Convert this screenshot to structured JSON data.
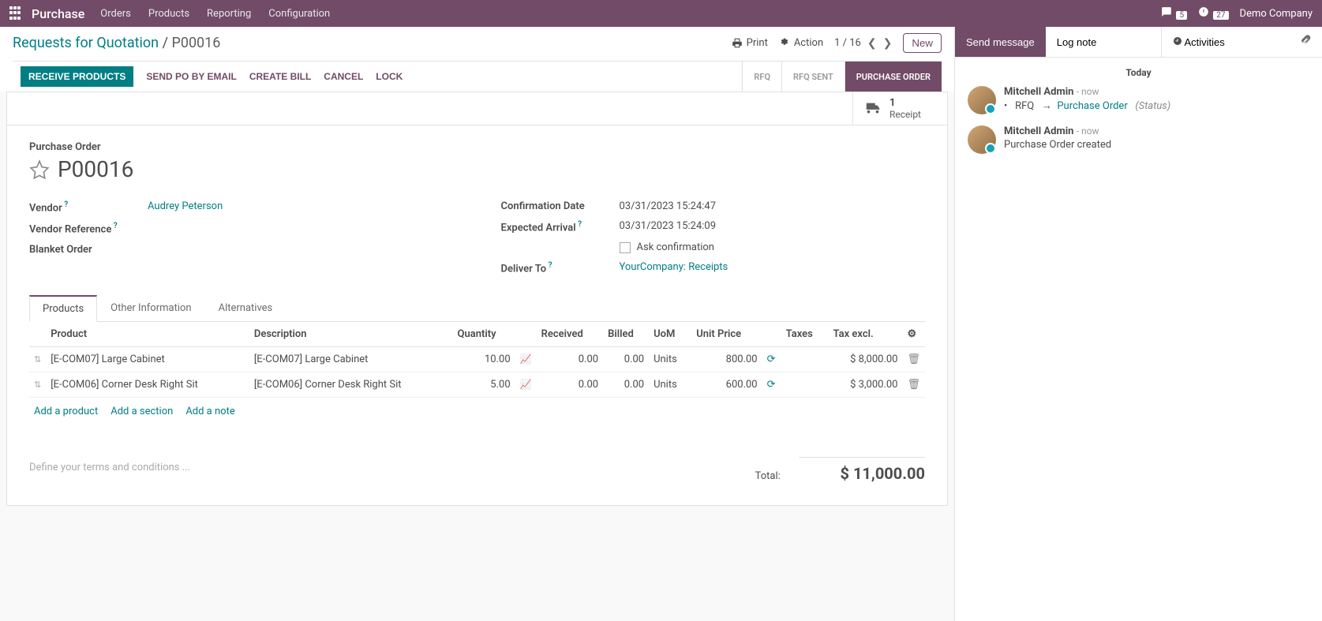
{
  "topnav": {
    "brand": "Purchase",
    "menu": [
      "Orders",
      "Products",
      "Reporting",
      "Configuration"
    ],
    "chat_badge": "5",
    "activity_badge": "27",
    "company": "Demo Company"
  },
  "breadcrumb": {
    "parent": "Requests for Quotation",
    "current": "P00016"
  },
  "control": {
    "print": "Print",
    "action": "Action",
    "pager": "1 / 16",
    "new": "New"
  },
  "actions": {
    "receive": "RECEIVE PRODUCTS",
    "sendpo": "SEND PO BY EMAIL",
    "createbill": "CREATE BILL",
    "cancel": "CANCEL",
    "lock": "LOCK"
  },
  "status": {
    "rfq": "RFQ",
    "rfqsent": "RFQ SENT",
    "po": "PURCHASE ORDER"
  },
  "stat": {
    "count": "1",
    "label": "Receipt"
  },
  "form": {
    "title_label": "Purchase Order",
    "name": "P00016",
    "vendor_label": "Vendor",
    "vendor": "Audrey Peterson",
    "vendor_ref_label": "Vendor Reference",
    "blanket_label": "Blanket Order",
    "confirm_label": "Confirmation Date",
    "confirm_date": "03/31/2023 15:24:47",
    "arrival_label": "Expected Arrival",
    "arrival_date": "03/31/2023 15:24:09",
    "ask_confirm": "Ask confirmation",
    "deliver_label": "Deliver To",
    "deliver_to": "YourCompany: Receipts"
  },
  "tabs": {
    "products": "Products",
    "other": "Other Information",
    "alt": "Alternatives"
  },
  "columns": {
    "product": "Product",
    "desc": "Description",
    "qty": "Quantity",
    "received": "Received",
    "billed": "Billed",
    "uom": "UoM",
    "unit": "Unit Price",
    "taxes": "Taxes",
    "taxexcl": "Tax excl."
  },
  "lines": [
    {
      "product": "[E-COM07] Large Cabinet",
      "desc": "[E-COM07] Large Cabinet",
      "qty": "10.00",
      "received": "0.00",
      "billed": "0.00",
      "uom": "Units",
      "unit": "800.00",
      "tax": "$ 8,000.00"
    },
    {
      "product": "[E-COM06] Corner Desk Right Sit",
      "desc": "[E-COM06] Corner Desk Right Sit",
      "qty": "5.00",
      "received": "0.00",
      "billed": "0.00",
      "uom": "Units",
      "unit": "600.00",
      "tax": "$ 3,000.00"
    }
  ],
  "line_actions": {
    "add_product": "Add a product",
    "add_section": "Add a section",
    "add_note": "Add a note"
  },
  "terms_placeholder": "Define your terms and conditions ...",
  "total": {
    "label": "Total:",
    "value": "$ 11,000.00"
  },
  "chatter": {
    "send": "Send message",
    "log": "Log note",
    "activities": "Activities",
    "today": "Today",
    "msg1": {
      "author": "Mitchell Admin",
      "time": "now",
      "rfq": "RFQ",
      "po_link": "Purchase Order",
      "status": "(Status)"
    },
    "msg2": {
      "author": "Mitchell Admin",
      "time": "now",
      "text": "Purchase Order created"
    }
  }
}
